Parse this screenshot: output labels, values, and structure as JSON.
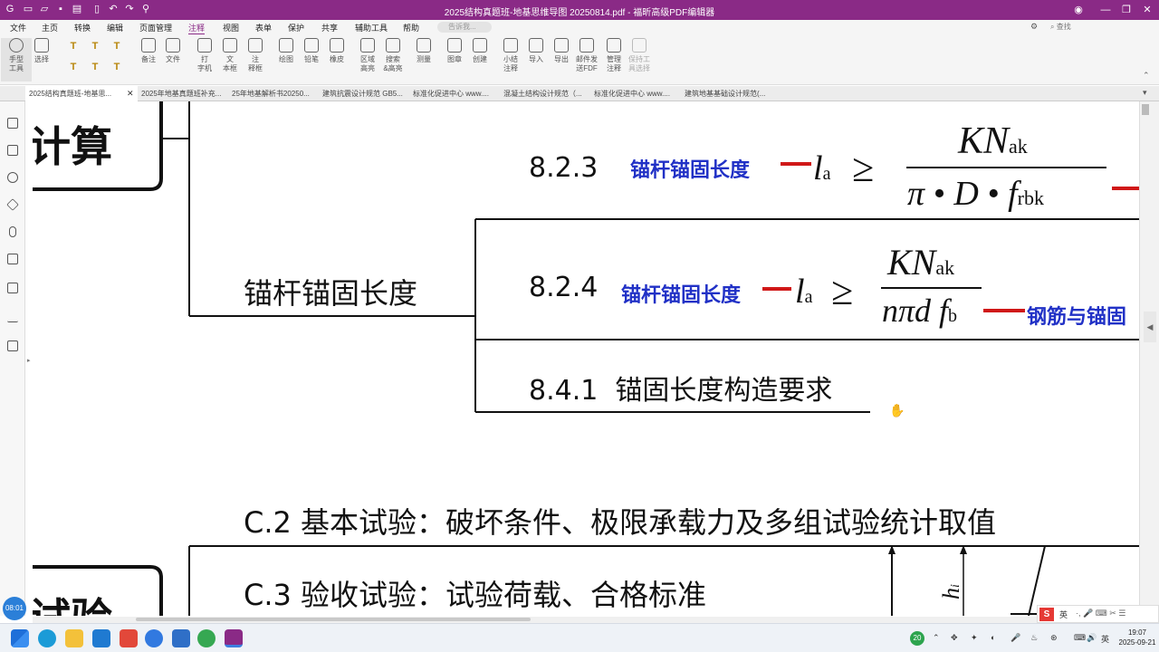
{
  "window": {
    "title": "2025结构真题班-地基思维导图 20250814.pdf - 福昕高级PDF编辑器"
  },
  "menu": {
    "items": [
      "文件",
      "主页",
      "转换",
      "编辑",
      "页面管理",
      "注释",
      "视图",
      "表单",
      "保护",
      "共享",
      "辅助工具",
      "帮助"
    ],
    "active": "注释",
    "search_placeholder": "告诉我...",
    "search_right_placeholder": "查找"
  },
  "ribbon": {
    "tools": [
      "手型\n工具",
      "选择",
      "备注",
      "文件",
      "打\n字机",
      "文\n本框",
      "注\n释框",
      "绘图",
      "铅笔",
      "橡皮",
      "区域\n高亮",
      "搜索\n&高亮",
      "测量",
      "图章",
      "创建",
      "小结\n注释",
      "导入",
      "导出",
      "邮件发\n送FDF",
      "管理\n注释",
      "保持工\n具选择"
    ],
    "small_icons": [
      "T",
      "T",
      "T",
      "T",
      "T",
      "T"
    ]
  },
  "tabs": [
    "2025结构真题班-地基思...",
    "2025年地基真题班补充...",
    "25年地基解析书20250...",
    "建筑抗震设计规范 GB5...",
    "标准化促进中心 www....",
    "混凝土结构设计规范（...",
    "标准化促进中心 www....",
    "建筑地基基础设计规范(..."
  ],
  "left_panel_icons": [
    "bookmark-icon",
    "pages-icon",
    "comment-icon",
    "layers-icon",
    "attachment-icon",
    "security-icon",
    "fields-icon",
    "signature-icon",
    "compare-icon"
  ],
  "document": {
    "left_heading_top": "计算",
    "left_heading_bottom": "试验",
    "branch_label": "锚杆锚固长度",
    "item1": {
      "code": "8.2.3",
      "label": "锚杆锚固长度",
      "formula_lhs": "l",
      "formula_lhs_sub": "a",
      "ge": "≥",
      "num": "KN",
      "num_sub": "ak",
      "den": "π • D • f",
      "den_sub": "rbk"
    },
    "item2": {
      "code": "8.2.4",
      "label": "锚杆锚固长度",
      "formula_lhs": "l",
      "formula_lhs_sub": "a",
      "ge": "≥",
      "num": "KN",
      "num_sub": "ak",
      "den": "nπd f",
      "den_sub": "b",
      "tail": "钢筋与锚固"
    },
    "item3": {
      "code": "8.4.1",
      "label": "锚固长度构造要求"
    },
    "c2": "C.2  基本试验：破坏条件、极限承载力及多组试验统计取值",
    "c3": "C.3  验收试验：试验荷载、合格标准",
    "figure_label": "h",
    "figure_label_sub": "i"
  },
  "timer": "08:01",
  "ime": {
    "label": "英"
  },
  "taskbar": {
    "badge": "20",
    "time": "19:07",
    "date": "2025-09-21"
  }
}
